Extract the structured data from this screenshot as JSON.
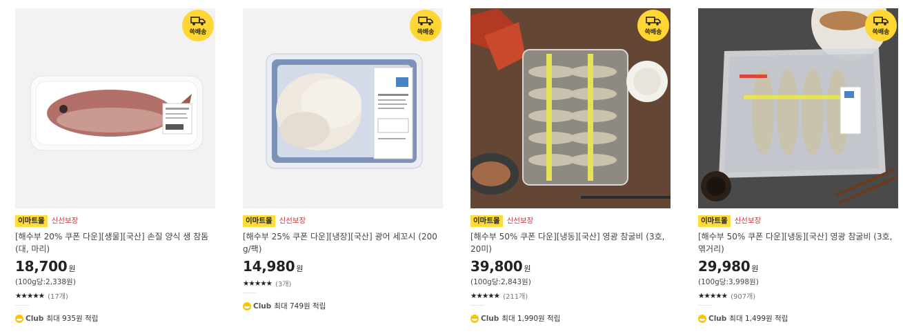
{
  "colors": {
    "mall_tag_bg": "#ffdc3d",
    "fresh_tag": "#e42a31",
    "badge_bg": "#ffd633",
    "club_icon": "#ffc400"
  },
  "products": [
    {
      "badge": "쓱배송",
      "mall_tag": "이마트몰",
      "fresh_tag": "신선보장",
      "title": "[해수부 20% 쿠폰 다운][생물][국산] 손질 양식 생 참돔 (대, 마리)",
      "price": "18,700",
      "currency": "원",
      "unit_price": "(100g당:2,338원)",
      "stars": "★★★★★",
      "rating_value": 5,
      "review_count": "(17개)",
      "club_label": "Club",
      "club_text": "최대 935원 적립"
    },
    {
      "badge": "쓱배송",
      "mall_tag": "이마트몰",
      "fresh_tag": "신선보장",
      "title": "[해수부 25% 쿠폰 다운][냉장][국산] 광어 세꼬시 (200g/팩)",
      "price": "14,980",
      "currency": "원",
      "unit_price": "",
      "stars": "★★★★★",
      "rating_value": 5,
      "review_count": "(3개)",
      "club_label": "Club",
      "club_text": "최대 749원 적립"
    },
    {
      "badge": "쓱배송",
      "mall_tag": "이마트몰",
      "fresh_tag": "신선보장",
      "title": "[해수부 50% 쿠폰 다운][냉동][국산] 영광 참굴비 (3호, 20미)",
      "price": "39,800",
      "currency": "원",
      "unit_price": "(100g당:2,843원)",
      "stars": "★★★★★",
      "rating_value": 4.5,
      "review_count": "(211개)",
      "club_label": "Club",
      "club_text": "최대 1,990원 적립"
    },
    {
      "badge": "쓱배송",
      "mall_tag": "이마트몰",
      "fresh_tag": "신선보장",
      "title": "[해수부 50% 쿠폰 다운][냉동][국산] 영광 참굴비 (3호, 엮거리)",
      "price": "29,980",
      "currency": "원",
      "unit_price": "(100g당:3,998원)",
      "stars": "★★★★★",
      "rating_value": 5,
      "review_count": "(907개)",
      "club_label": "Club",
      "club_text": "최대 1,499원 적립"
    }
  ]
}
